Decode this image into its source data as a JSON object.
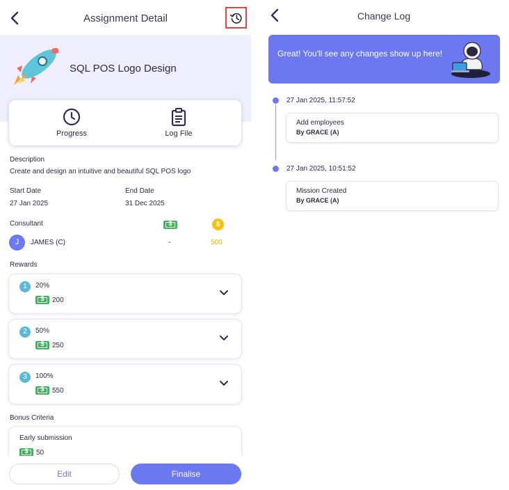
{
  "detail": {
    "header_title": "Assignment Detail",
    "assignment_name": "SQL POS Logo Design",
    "tabs": [
      {
        "label": "Progress",
        "icon": "clock-icon"
      },
      {
        "label": "Log File",
        "icon": "clipboard-icon"
      }
    ],
    "description_label": "Description",
    "description": "Create and design an intuitive and beautiful SQL POS logo",
    "start_date_label": "Start Date",
    "start_date": "27 Jan 2025",
    "end_date_label": "End Date",
    "end_date": "31 Dec 2025",
    "consultant_label": "Consultant",
    "consultant": {
      "initial": "J",
      "name": "JAMES (C)",
      "cash": "-",
      "coins": "500",
      "coin_symbol": "$"
    },
    "rewards_label": "Rewards",
    "rewards": [
      {
        "index": "1",
        "percent": "20%",
        "amount": "200"
      },
      {
        "index": "2",
        "percent": "50%",
        "amount": "250"
      },
      {
        "index": "3",
        "percent": "100%",
        "amount": "550"
      }
    ],
    "bonus_label": "Bonus Criteria",
    "bonus": {
      "title": "Early submission",
      "amount": "50"
    },
    "edit_label": "Edit",
    "finalise_label": "Finalise"
  },
  "change_log": {
    "header_title": "Change Log",
    "banner_text": "Great! You'll see any changes show up here!",
    "entries": [
      {
        "time": "27 Jan 2025, 11:57:52",
        "title": "Add employees",
        "by": "By GRACE (A)"
      },
      {
        "time": "27 Jan 2025, 10:51:52",
        "title": "Mission Created",
        "by": "By GRACE (A)"
      }
    ]
  },
  "colors": {
    "accent": "#6b78ef",
    "hero_bg": "#eeeefc",
    "cash_green": "#3fb65b",
    "coin_yellow": "#f7c20a",
    "badge_blue": "#5cb8d8",
    "highlight_red": "#e44343"
  }
}
